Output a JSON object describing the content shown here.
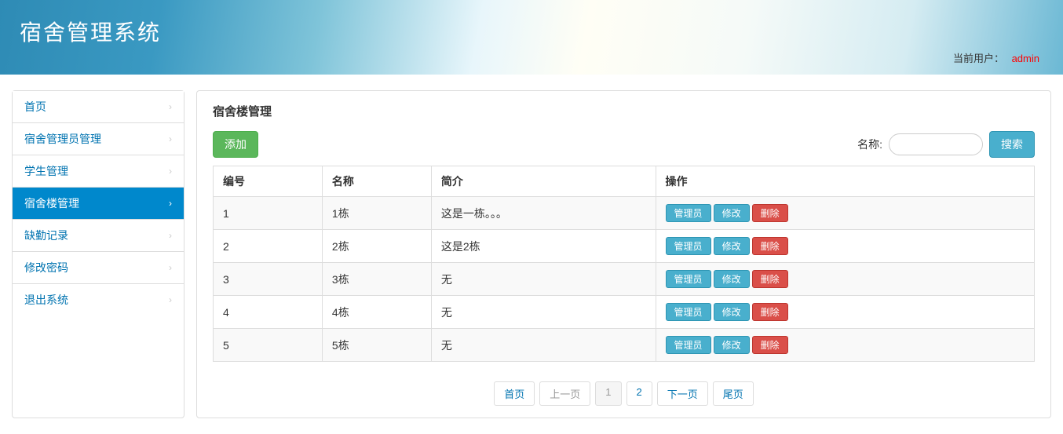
{
  "header": {
    "title": "宿舍管理系统",
    "user_label": "当前用户：",
    "username": "admin"
  },
  "sidebar": {
    "items": [
      {
        "label": "首页",
        "active": false
      },
      {
        "label": "宿舍管理员管理",
        "active": false
      },
      {
        "label": "学生管理",
        "active": false
      },
      {
        "label": "宿舍楼管理",
        "active": true
      },
      {
        "label": "缺勤记录",
        "active": false
      },
      {
        "label": "修改密码",
        "active": false
      },
      {
        "label": "退出系统",
        "active": false
      }
    ]
  },
  "main": {
    "title": "宿舍楼管理",
    "add_label": "添加",
    "search_label": "名称:",
    "search_value": "",
    "search_button": "搜索",
    "columns": [
      "编号",
      "名称",
      "简介",
      "操作"
    ],
    "rows": [
      {
        "id": "1",
        "name": "1栋",
        "desc": "这是一栋。。。"
      },
      {
        "id": "2",
        "name": "2栋",
        "desc": "这是2栋"
      },
      {
        "id": "3",
        "name": "3栋",
        "desc": "无"
      },
      {
        "id": "4",
        "name": "4栋",
        "desc": "无"
      },
      {
        "id": "5",
        "name": "5栋",
        "desc": "无"
      }
    ],
    "row_actions": {
      "manager": "管理员",
      "edit": "修改",
      "delete": "删除"
    },
    "pagination": {
      "first": "首页",
      "prev": "上一页",
      "pages": [
        "1",
        "2"
      ],
      "current": "1",
      "next": "下一页",
      "last": "尾页"
    }
  }
}
